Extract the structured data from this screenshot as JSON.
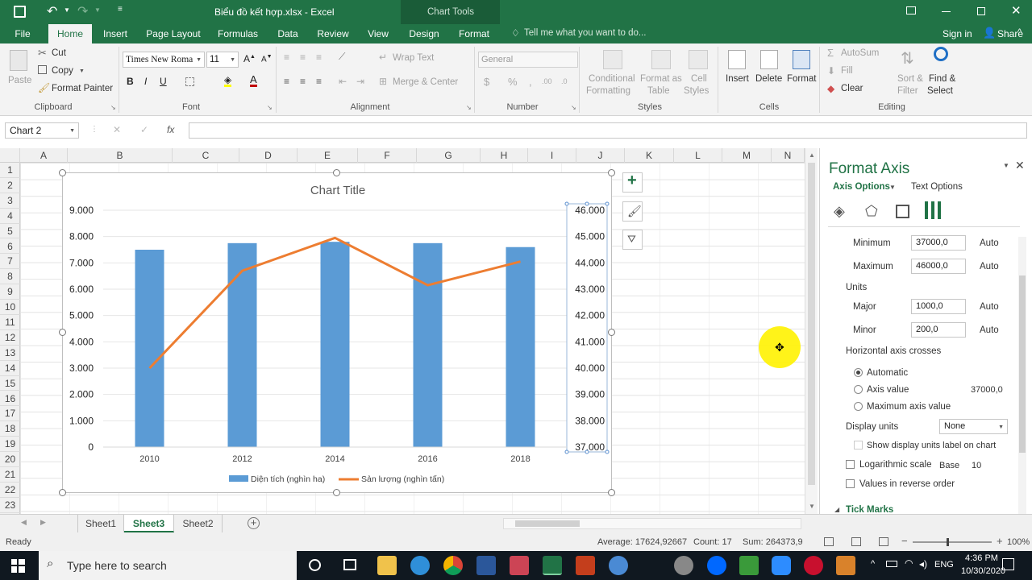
{
  "titlebar": {
    "title": "Biểu đồ kết hợp.xlsx - Excel",
    "context": "Chart Tools"
  },
  "tabs": [
    "File",
    "Home",
    "Insert",
    "Page Layout",
    "Formulas",
    "Data",
    "Review",
    "View",
    "Design",
    "Format"
  ],
  "tell_me": "Tell me what you want to do...",
  "signin": "Sign in",
  "share": "Share",
  "ribbon": {
    "clipboard": {
      "paste": "Paste",
      "cut": "Cut",
      "copy": "Copy",
      "painter": "Format Painter",
      "label": "Clipboard"
    },
    "font": {
      "name": "Times New Roma",
      "size": "11",
      "label": "Font"
    },
    "alignment": {
      "wrap": "Wrap Text",
      "merge": "Merge & Center",
      "label": "Alignment"
    },
    "number": {
      "format": "General",
      "label": "Number"
    },
    "styles": {
      "cond": "Conditional",
      "cond2": "Formatting",
      "fmt_table": "Format as",
      "fmt_table2": "Table",
      "cell": "Cell",
      "cell2": "Styles",
      "label": "Styles"
    },
    "cells": {
      "insert": "Insert",
      "delete": "Delete",
      "format": "Format",
      "label": "Cells"
    },
    "editing": {
      "autosum": "AutoSum",
      "fill": "Fill",
      "clear": "Clear",
      "sort": "Sort &",
      "sort2": "Filter",
      "find": "Find &",
      "find2": "Select",
      "label": "Editing"
    }
  },
  "namebox": "Chart 2",
  "columns": [
    "A",
    "B",
    "C",
    "D",
    "E",
    "F",
    "G",
    "H",
    "I",
    "J",
    "K",
    "L",
    "M",
    "N"
  ],
  "rows": [
    "1",
    "2",
    "3",
    "4",
    "5",
    "6",
    "7",
    "8",
    "9",
    "10",
    "11",
    "12",
    "13",
    "14",
    "15",
    "16",
    "17",
    "18",
    "19",
    "20",
    "21",
    "22",
    "23"
  ],
  "chart_data": {
    "type": "bar",
    "title": "Chart Title",
    "categories": [
      "2010",
      "2012",
      "2014",
      "2016",
      "2018"
    ],
    "series": [
      {
        "name": "Diện tích (nghìn ha)",
        "type": "bar",
        "axis": "left",
        "color": "#5b9bd5",
        "values": [
          7500,
          7750,
          7800,
          7750,
          7600
        ]
      },
      {
        "name": "Sản lượng (nghìn tấn)",
        "type": "line",
        "axis": "right",
        "color": "#ed7d31",
        "values": [
          40000,
          43700,
          44950,
          43150,
          44050
        ]
      }
    ],
    "left_ticks": [
      "0",
      "1.000",
      "2.000",
      "3.000",
      "4.000",
      "5.000",
      "6.000",
      "7.000",
      "8.000",
      "9.000"
    ],
    "right_ticks": [
      "37.000",
      "38.000",
      "39.000",
      "40.000",
      "41.000",
      "42.000",
      "43.000",
      "44.000",
      "45.000",
      "46.000"
    ],
    "ylim": [
      0,
      9000
    ],
    "y2lim": [
      37000,
      46000
    ],
    "legend": "bottom"
  },
  "pane": {
    "title": "Format Axis",
    "axis_options": "Axis Options",
    "text_options": "Text Options",
    "minimum": "Minimum",
    "minimum_val": "37000,0",
    "maximum": "Maximum",
    "maximum_val": "46000,0",
    "auto": "Auto",
    "units": "Units",
    "major": "Major",
    "major_val": "1000,0",
    "minor": "Minor",
    "minor_val": "200,0",
    "crosses": "Horizontal axis crosses",
    "automatic": "Automatic",
    "axis_value": "Axis value",
    "axis_value_val": "37000,0",
    "max_axis": "Maximum axis value",
    "display_units": "Display units",
    "display_units_val": "None",
    "show_label": "Show display units label on chart",
    "log": "Logarithmic scale",
    "base": "Base",
    "base_val": "10",
    "reverse": "Values in reverse order",
    "tick_marks": "Tick Marks"
  },
  "sheets": [
    "Sheet1",
    "Sheet3",
    "Sheet2"
  ],
  "status": {
    "ready": "Ready",
    "average": "Average: 17624,92667",
    "count": "Count: 17",
    "sum": "Sum: 264373,9",
    "zoom": "100%"
  },
  "taskbar": {
    "search": "Type here to search",
    "lang": "ENG",
    "time": "4:36 PM",
    "date": "10/30/2020"
  }
}
